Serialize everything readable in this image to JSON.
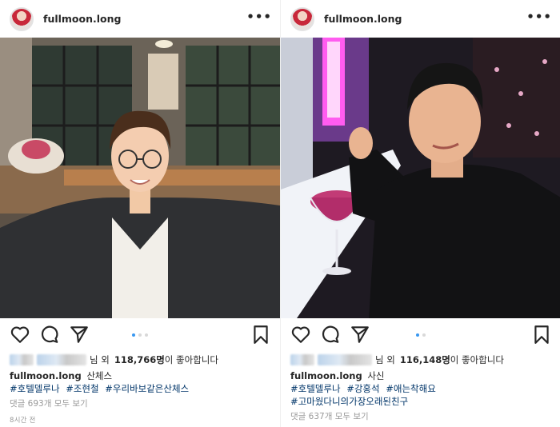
{
  "posts": [
    {
      "username": "fullmoon.long",
      "more": "•••",
      "likes": {
        "prefix": "님 외",
        "count": "118,766명",
        "suffix": "이 좋아합니다"
      },
      "caption": {
        "user": "fullmoon.long",
        "text": "산체스"
      },
      "hashtags": [
        "#호텔델루나",
        "#조현철",
        "#우리바보같은산체스"
      ],
      "comments": "댓글 693개 모두 보기",
      "time": "8시간 전"
    },
    {
      "username": "fullmoon.long",
      "more": "•••",
      "likes": {
        "prefix": "님 외",
        "count": "116,148명",
        "suffix": "이 좋아합니다"
      },
      "caption": {
        "user": "fullmoon.long",
        "text": "사신"
      },
      "hashtags": [
        "#호텔델루나",
        "#강홍석",
        "#애는착해요"
      ],
      "hashtags2": [
        "#고마웠다니의가장오래된친구"
      ],
      "comments": "댓글 637개 모두 보기"
    }
  ],
  "icons": [
    "heart-icon",
    "comment-icon",
    "share-icon",
    "bookmark-icon"
  ],
  "colors": {
    "hashtag": "#003569",
    "muted": "#999999",
    "text": "#262626",
    "carousel_active": "#3897f0"
  }
}
